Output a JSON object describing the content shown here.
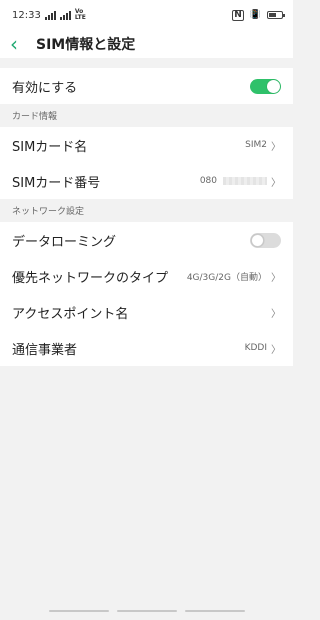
{
  "status_bar": {
    "time": "12:33",
    "network_left": "",
    "volte": "Vo\nLTE",
    "network_right": "",
    "battery_level": 0.6
  },
  "header": {
    "title": "SIM情報と設定"
  },
  "enable_row": {
    "label": "有効にする",
    "enabled": true
  },
  "card_info": {
    "section_title": "カード情報",
    "sim_name_label": "SIMカード名",
    "sim_name_value": "SIM2",
    "sim_number_label": "SIMカード番号",
    "sim_number_value": "080"
  },
  "network_settings": {
    "section_title": "ネットワーク設定",
    "roaming_label": "データローミング",
    "roaming_enabled": false,
    "preferred_network_label": "優先ネットワークのタイプ",
    "preferred_network_value": "4G/3G/2G（自動）",
    "apn_label": "アクセスポイント名",
    "carrier_label": "通信事業者",
    "carrier_value": "KDDI"
  },
  "colors": {
    "accent": "#1fa870",
    "toggle_on": "#2fc16a"
  }
}
